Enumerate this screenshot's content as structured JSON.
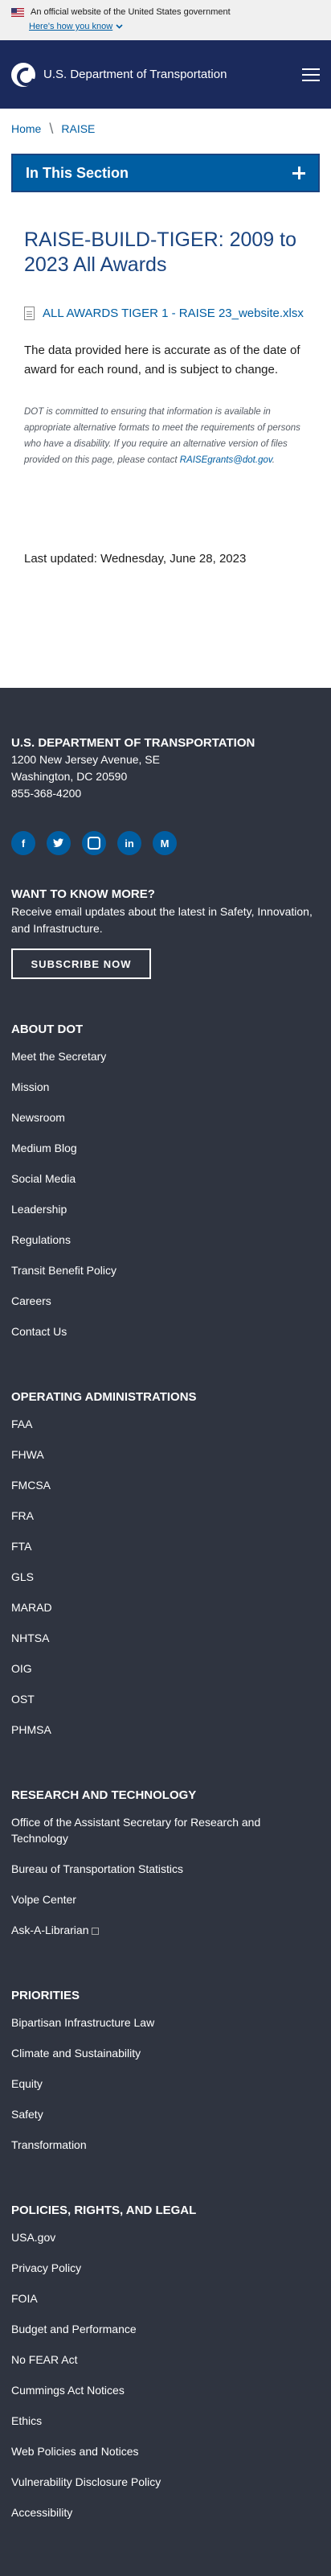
{
  "gov_banner": {
    "official_text": "An official website of the United States government",
    "toggle_text": "Here's how you know"
  },
  "header": {
    "site_title": "U.S. Department of Transportation"
  },
  "breadcrumb": [
    "Home",
    "RAISE"
  ],
  "section_nav": {
    "label": "In This Section"
  },
  "main": {
    "title": "RAISE-BUILD-TIGER: 2009 to 2023 All Awards",
    "file_link": "ALL AWARDS TIGER 1 - RAISE 23_website.xlsx",
    "intro": "The data provided here is accurate as of the date of award for each round, and is subject to change.",
    "notice_text": "DOT is committed to ensuring that information is available in appropriate alternative formats to meet the requirements of persons who have a disability. If you require an alternative version of files provided on this page, please contact",
    "notice_email": "RAISEgrants@dot.gov",
    "notice_suffix": ".",
    "last_updated": "Last updated: Wednesday, June 28, 2023"
  },
  "footer": {
    "org": "U.S. DEPARTMENT OF TRANSPORTATION",
    "address1": "1200 New Jersey Avenue, SE",
    "address2": "Washington, DC 20590",
    "phone": "855-368-4200",
    "socials": [
      "facebook-icon",
      "twitter-icon",
      "instagram-icon",
      "linkedin-icon",
      "medium-icon"
    ],
    "know_title": "WANT TO KNOW MORE?",
    "know_text": "Receive email updates about the latest in Safety, Innovation, and Infrastructure.",
    "subscribe_label": "SUBSCRIBE NOW",
    "groups": [
      {
        "title": "ABOUT DOT",
        "links": [
          "Meet the Secretary",
          "Mission",
          "Newsroom",
          "Medium Blog",
          "Social Media",
          "Leadership",
          "Regulations",
          "Transit Benefit Policy",
          "Careers",
          "Contact Us"
        ]
      },
      {
        "title": "OPERATING ADMINISTRATIONS",
        "links": [
          "FAA",
          "FHWA",
          "FMCSA",
          "FRA",
          "FTA",
          "GLS",
          "MARAD",
          "NHTSA",
          "OIG",
          "OST",
          "PHMSA"
        ]
      },
      {
        "title": "RESEARCH AND TECHNOLOGY",
        "links": [
          "Office of the Assistant Secretary for Research and Technology",
          "Bureau of Transportation Statistics",
          "Volpe Center",
          "Ask-A-Librarian"
        ]
      },
      {
        "title": "PRIORITIES",
        "links": [
          "Bipartisan Infrastructure Law",
          "Climate and Sustainability",
          "Equity",
          "Safety",
          "Transformation"
        ]
      },
      {
        "title": "POLICIES, RIGHTS, AND LEGAL",
        "links": [
          "USA.gov",
          "Privacy Policy",
          "FOIA",
          "Budget and Performance",
          "No FEAR Act",
          "Cummings Act Notices",
          "Ethics",
          "Web Policies and Notices",
          "Vulnerability Disclosure Policy",
          "Accessibility"
        ]
      }
    ]
  },
  "colors": {
    "header_bg": "#1b2a5c",
    "accent": "#005ea2",
    "title": "#1a4480",
    "footer_bg": "#2f3440"
  }
}
